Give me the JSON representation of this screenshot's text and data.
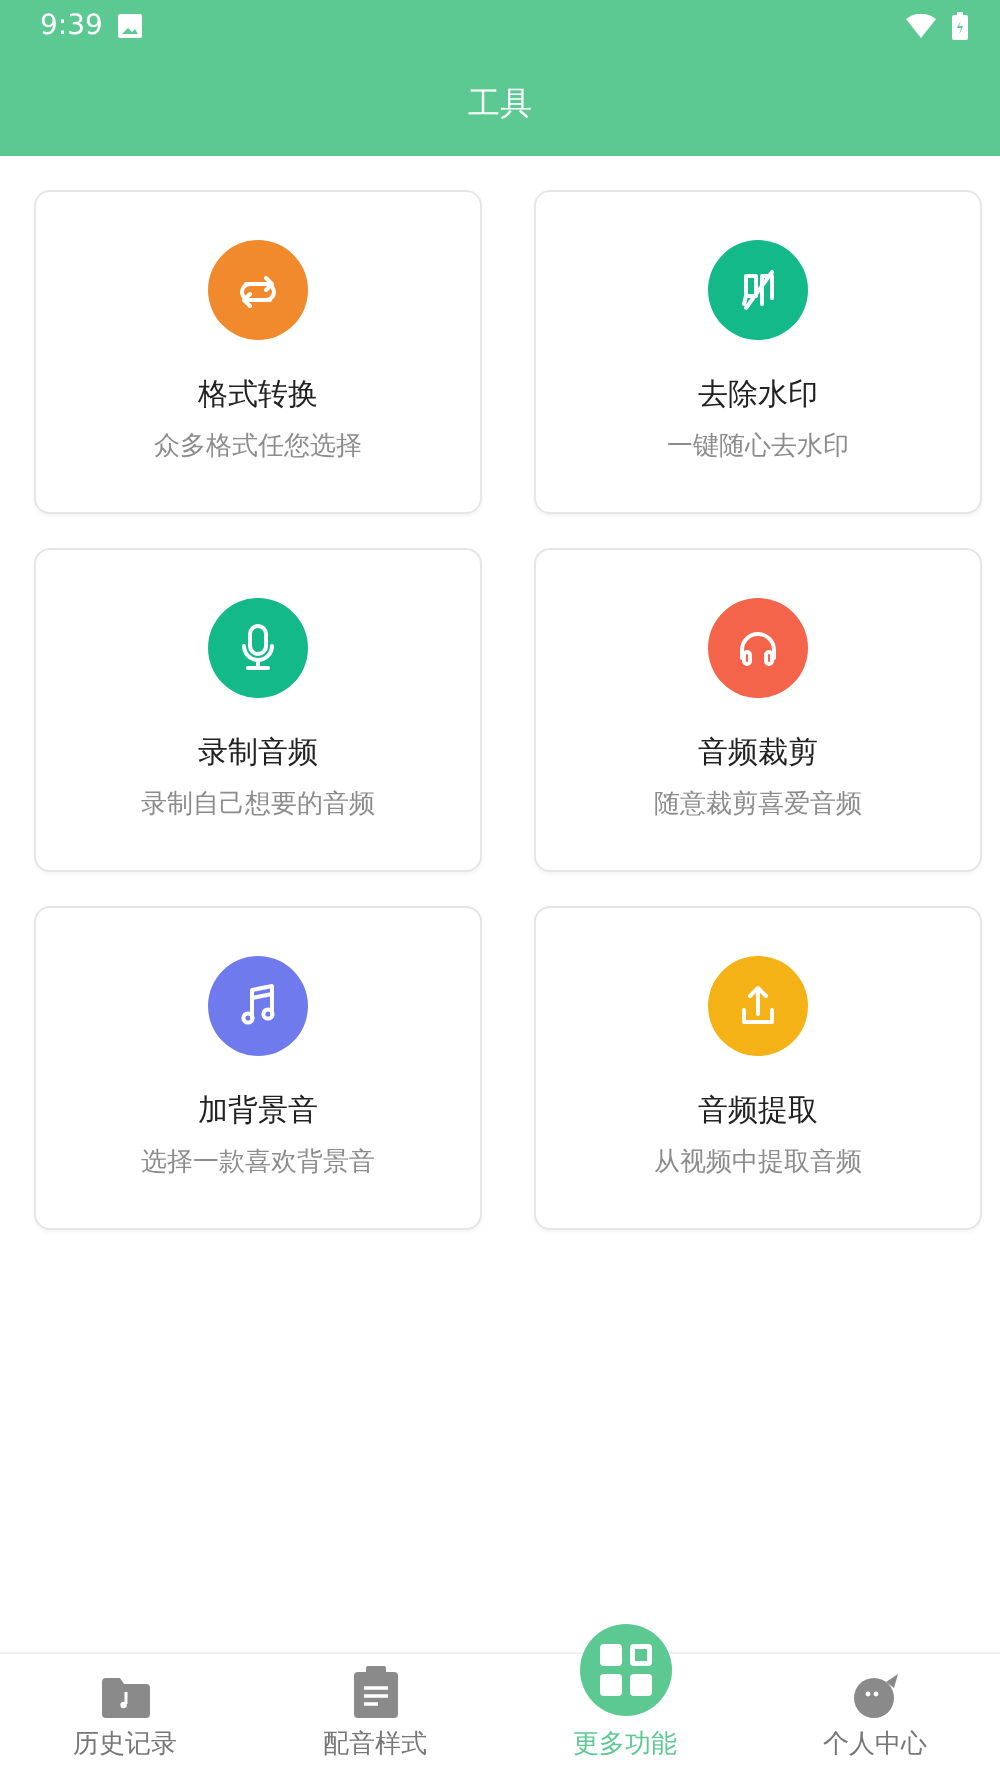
{
  "status_bar": {
    "time": "9:39"
  },
  "header": {
    "title": "工具"
  },
  "tools": [
    {
      "kind": "convert",
      "color": "#f08a2c",
      "title": "格式转换",
      "subtitle": "众多格式任您选择"
    },
    {
      "kind": "watermark",
      "color": "#14b98a",
      "title": "去除水印",
      "subtitle": "一键随心去水印"
    },
    {
      "kind": "mic",
      "color": "#14b98a",
      "title": "录制音频",
      "subtitle": "录制自己想要的音频"
    },
    {
      "kind": "headphones",
      "color": "#f4644a",
      "title": "音频裁剪",
      "subtitle": "随意裁剪喜爱音频"
    },
    {
      "kind": "music",
      "color": "#6f7bec",
      "title": "加背景音",
      "subtitle": "选择一款喜欢背景音"
    },
    {
      "kind": "upload",
      "color": "#f5b216",
      "title": "音频提取",
      "subtitle": "从视频中提取音频"
    }
  ],
  "bottom_nav": [
    {
      "kind": "history",
      "label": "历史记录",
      "selected": false
    },
    {
      "kind": "styles",
      "label": "配音样式",
      "selected": false
    },
    {
      "kind": "more",
      "label": "更多功能",
      "selected": true
    },
    {
      "kind": "profile",
      "label": "个人中心",
      "selected": false
    }
  ]
}
